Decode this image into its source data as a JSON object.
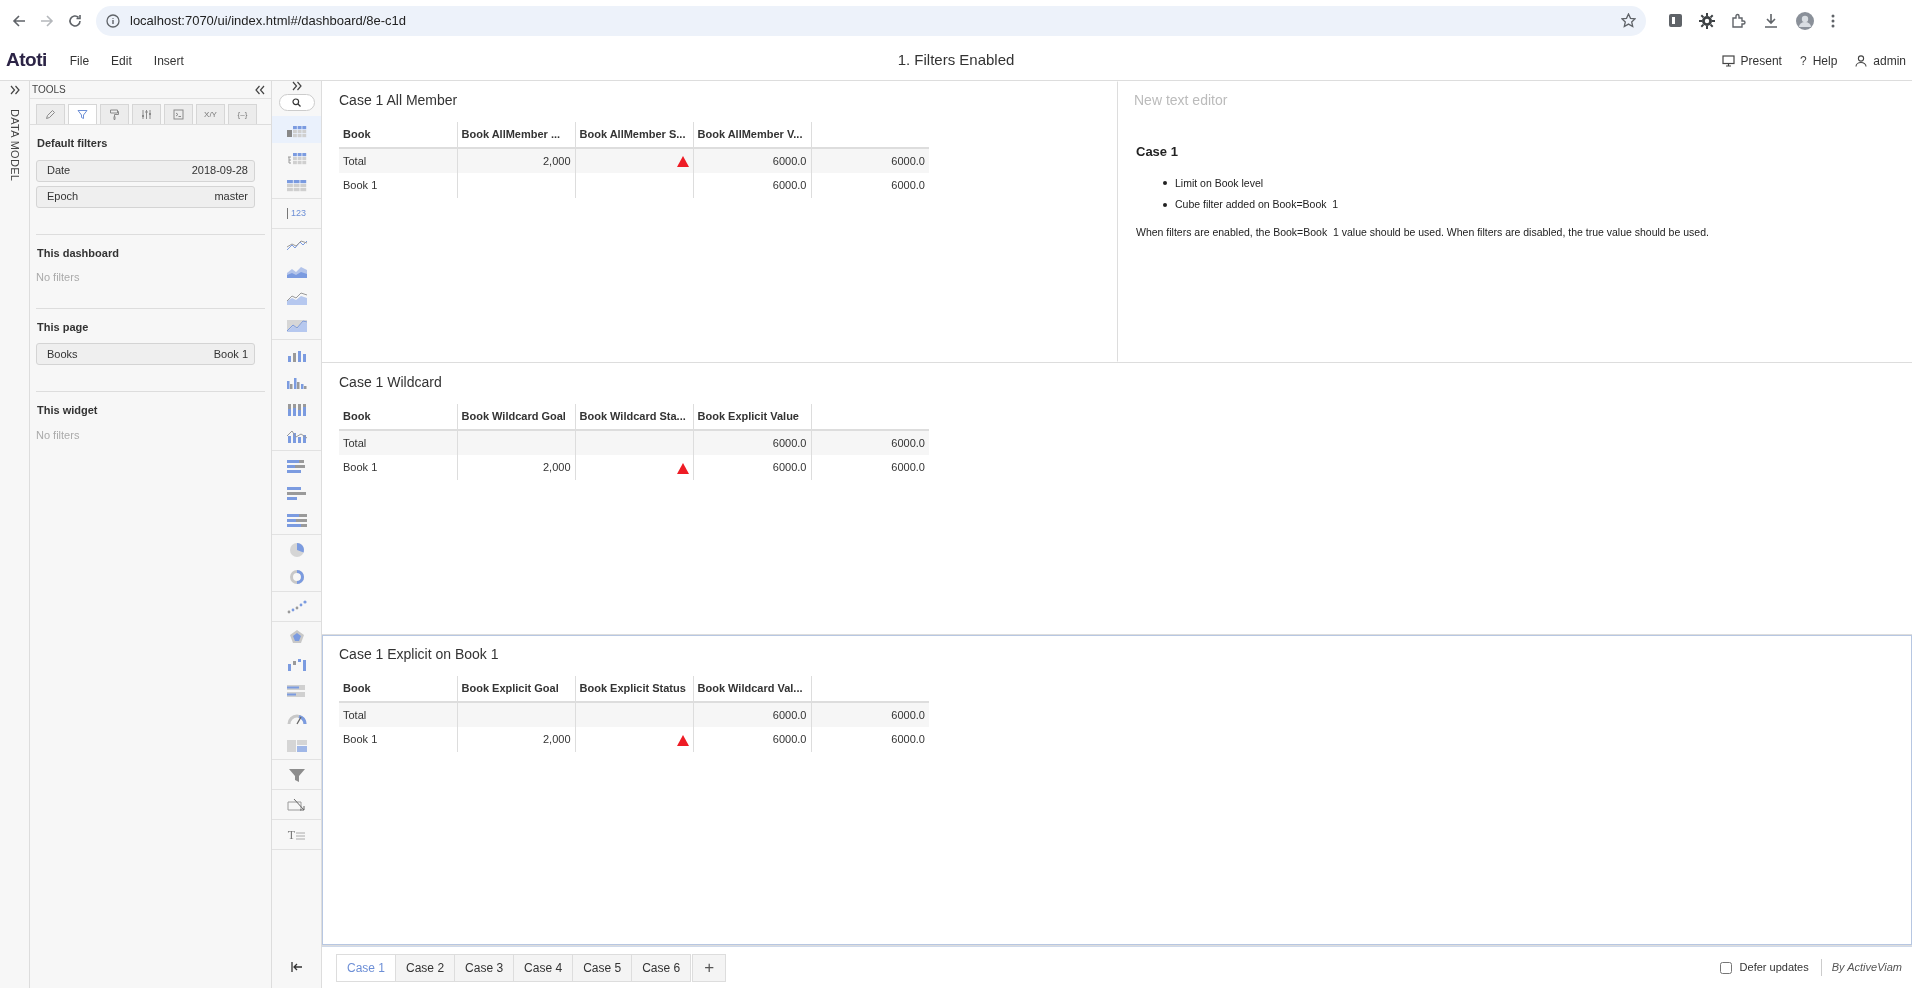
{
  "browser": {
    "url": "localhost:7070/ui/index.html#/dashboard/8e-c1d"
  },
  "app": {
    "logo": "Atoti",
    "menus": [
      "File",
      "Edit",
      "Insert"
    ],
    "page_title": "1. Filters Enabled",
    "actions": [
      {
        "kind": "present",
        "label": "Present"
      },
      {
        "kind": "help",
        "icon_text": "?",
        "label": "Help"
      },
      {
        "kind": "user",
        "label": "admin"
      }
    ]
  },
  "data_model_drawer": {
    "label": "DATA MODEL"
  },
  "tools": {
    "title": "TOOLS",
    "tabs": [
      {
        "kind": "pencil",
        "selected": false
      },
      {
        "kind": "filter",
        "selected": true
      },
      {
        "kind": "paint",
        "selected": false
      },
      {
        "kind": "sliders",
        "selected": false
      },
      {
        "kind": "terminal",
        "selected": false
      },
      {
        "kind": "text",
        "label": "X/Y",
        "selected": false
      },
      {
        "kind": "text",
        "label": "{–}",
        "selected": false
      }
    ],
    "sections": [
      {
        "title": "Default filters",
        "filters": [
          {
            "label": "Date",
            "value": "2018-09-28"
          },
          {
            "label": "Epoch",
            "value": "master"
          }
        ]
      },
      {
        "title": "This dashboard",
        "empty_text": "No filters"
      },
      {
        "title": "This page",
        "filters": [
          {
            "label": "Books",
            "value": "Book 1"
          }
        ]
      },
      {
        "title": "This widget",
        "empty_text": "No filters"
      }
    ]
  },
  "widget_palette": {
    "groups": [
      {
        "items": [
          {
            "kind": "pivot-table",
            "selected": true
          },
          {
            "kind": "tree-table",
            "selected": false
          },
          {
            "kind": "table",
            "selected": false
          }
        ]
      },
      {
        "items": [
          {
            "kind": "kpi",
            "label": "123",
            "selected": false
          }
        ]
      },
      {
        "items": [
          {
            "kind": "line",
            "selected": false
          },
          {
            "kind": "area-stacked",
            "selected": false
          },
          {
            "kind": "area",
            "selected": false
          },
          {
            "kind": "area-single",
            "selected": false
          }
        ]
      },
      {
        "items": [
          {
            "kind": "column",
            "selected": false
          },
          {
            "kind": "column-clustered",
            "selected": false
          },
          {
            "kind": "column-stacked",
            "selected": false
          },
          {
            "kind": "column-combo",
            "selected": false
          }
        ]
      },
      {
        "items": [
          {
            "kind": "bar-stacked",
            "selected": false
          },
          {
            "kind": "bar",
            "selected": false
          },
          {
            "kind": "bar-full",
            "selected": false
          }
        ]
      },
      {
        "items": [
          {
            "kind": "pie",
            "selected": false
          },
          {
            "kind": "donut",
            "selected": false
          }
        ]
      },
      {
        "items": [
          {
            "kind": "scatter",
            "selected": false
          }
        ]
      },
      {
        "items": [
          {
            "kind": "radar",
            "selected": false
          },
          {
            "kind": "waterfall",
            "selected": false
          },
          {
            "kind": "bullet",
            "selected": false
          },
          {
            "kind": "gauge",
            "selected": false
          },
          {
            "kind": "layout",
            "selected": false
          }
        ]
      },
      {
        "items": [
          {
            "kind": "filter",
            "selected": false
          }
        ]
      },
      {
        "items": [
          {
            "kind": "drillthrough",
            "selected": false
          }
        ]
      },
      {
        "items": [
          {
            "kind": "text",
            "label": "T",
            "selected": false
          }
        ]
      }
    ]
  },
  "dashboard": {
    "rows": [
      {
        "widgets": [
          {
            "kind": "table",
            "title": "Case 1 All Member",
            "selected": false,
            "columns": [
              "Book",
              "Book AllMember ...",
              "Book AllMember S...",
              "Book AllMember V..."
            ],
            "rows": [
              {
                "book": "Total",
                "goal": "2,000",
                "warning": true,
                "values": [
                  "6000.0",
                  "6000.0"
                ]
              },
              {
                "book": "Book 1",
                "warning": false,
                "values": [
                  "6000.0",
                  "6000.0"
                ]
              }
            ]
          },
          {
            "kind": "text",
            "title_placeholder": "New text editor",
            "selected": false,
            "heading": "Case 1",
            "bullets": [
              "Limit on Book level",
              "Cube filter added on Book=Book  1"
            ],
            "paragraph": "When filters are enabled, the Book=Book  1 value should be used. When filters are disabled, the true value should be used."
          }
        ]
      },
      {
        "widgets": [
          {
            "kind": "table",
            "title": "Case 1 Wildcard",
            "selected": false,
            "columns": [
              "Book",
              "Book Wildcard Goal",
              "Book Wildcard Sta...",
              "Book Explicit Value"
            ],
            "rows": [
              {
                "book": "Total",
                "warning": false,
                "values": [
                  "6000.0",
                  "6000.0"
                ]
              },
              {
                "book": "Book 1",
                "goal": "2,000",
                "warning": true,
                "values": [
                  "6000.0",
                  "6000.0"
                ]
              }
            ]
          }
        ]
      },
      {
        "widgets": [
          {
            "kind": "table",
            "title": "Case 1 Explicit on Book 1",
            "selected": true,
            "columns": [
              "Book",
              "Book Explicit Goal",
              "Book Explicit Status",
              "Book Wildcard Val..."
            ],
            "rows": [
              {
                "book": "Total",
                "warning": false,
                "values": [
                  "6000.0",
                  "6000.0"
                ]
              },
              {
                "book": "Book 1",
                "goal": "2,000",
                "warning": true,
                "values": [
                  "6000.0",
                  "6000.0"
                ]
              }
            ]
          }
        ]
      }
    ]
  },
  "page_tabs": [
    {
      "label": "Case 1",
      "selected": true
    },
    {
      "label": "Case 2",
      "selected": false
    },
    {
      "label": "Case 3",
      "selected": false
    },
    {
      "label": "Case 4",
      "selected": false
    },
    {
      "label": "Case 5",
      "selected": false
    },
    {
      "label": "Case 6",
      "selected": false
    }
  ],
  "add_page_label": "+",
  "defer_updates": {
    "label": "Defer updates",
    "checked": false
  },
  "footer_brand": "By ActiveViam"
}
